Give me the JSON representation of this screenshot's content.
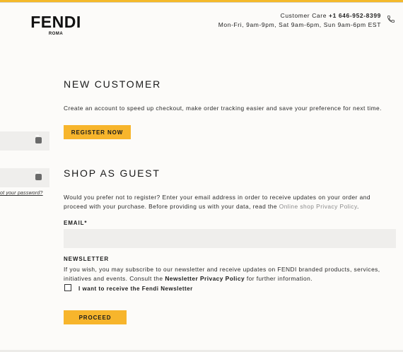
{
  "brand": {
    "logo": "FENDI",
    "sub": "ROMA",
    "accent": "#f7b52c"
  },
  "contact": {
    "care_label": "Customer Care",
    "phone": "+1 646-952-8399",
    "hours": "Mon-Fri, 9am-9pm, Sat 9am-6pm, Sun 9am-6pm EST",
    "icon": "phone-icon"
  },
  "login": {
    "forgot": "ot your password?"
  },
  "new_customer": {
    "title": "NEW CUSTOMER",
    "text": "Create an account to speed up checkout, make order tracking easier and save your preference for next time.",
    "button": "REGISTER NOW"
  },
  "guest": {
    "title": "SHOP AS GUEST",
    "text": "Would you prefer not to register? Enter your email address in order to receive updates on your order and proceed with your purchase. Before providing us with your data, read the",
    "policy_link": "Online shop Privacy Policy",
    "email_label": "EMAIL*",
    "email_value": "",
    "newsletter_label": "NEWSLETTER",
    "newsletter_text": "If you wish, you may subscribe to our newsletter and receive updates on FENDI branded products, services, initiatives and events. Consult the",
    "newsletter_policy": "Newsletter Privacy Policy",
    "newsletter_tail": "for further information.",
    "checkbox_label": "I want to receive the Fendi Newsletter",
    "checkbox_checked": false,
    "proceed": "PROCEED"
  }
}
